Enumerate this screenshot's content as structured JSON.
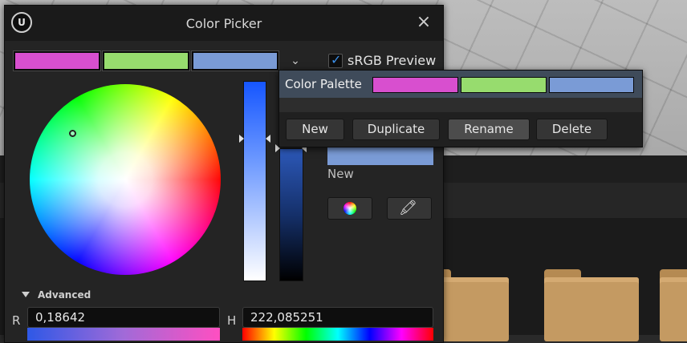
{
  "window": {
    "title": "Color Picker",
    "logo_text": "U",
    "close_icon": "×"
  },
  "top_swatches": [
    {
      "color": "#d84fcf"
    },
    {
      "color": "#97dc6e"
    },
    {
      "color": "#7a9bd6"
    }
  ],
  "srgb_preview": {
    "label": "sRGB Preview",
    "checked": true,
    "accent": "#3b8fe8"
  },
  "new_color": {
    "label": "New",
    "color": "#7a9bd6"
  },
  "advanced": {
    "label": "Advanced"
  },
  "channels": {
    "r": {
      "label": "R",
      "value": "0,18642"
    },
    "h": {
      "label": "H",
      "value": "222,085251"
    }
  },
  "palette": {
    "title": "Color Palette",
    "swatches": [
      {
        "color": "#d84fcf"
      },
      {
        "color": "#97dc6e"
      },
      {
        "color": "#7a9bd6"
      }
    ],
    "buttons": {
      "new": "New",
      "duplicate": "Duplicate",
      "rename": "Rename",
      "delete": "Delete"
    }
  },
  "icons": {
    "chevron": "chevron-down-icon",
    "color_wheel": "color-wheel-icon",
    "eyedropper": "eyedropper-icon"
  }
}
